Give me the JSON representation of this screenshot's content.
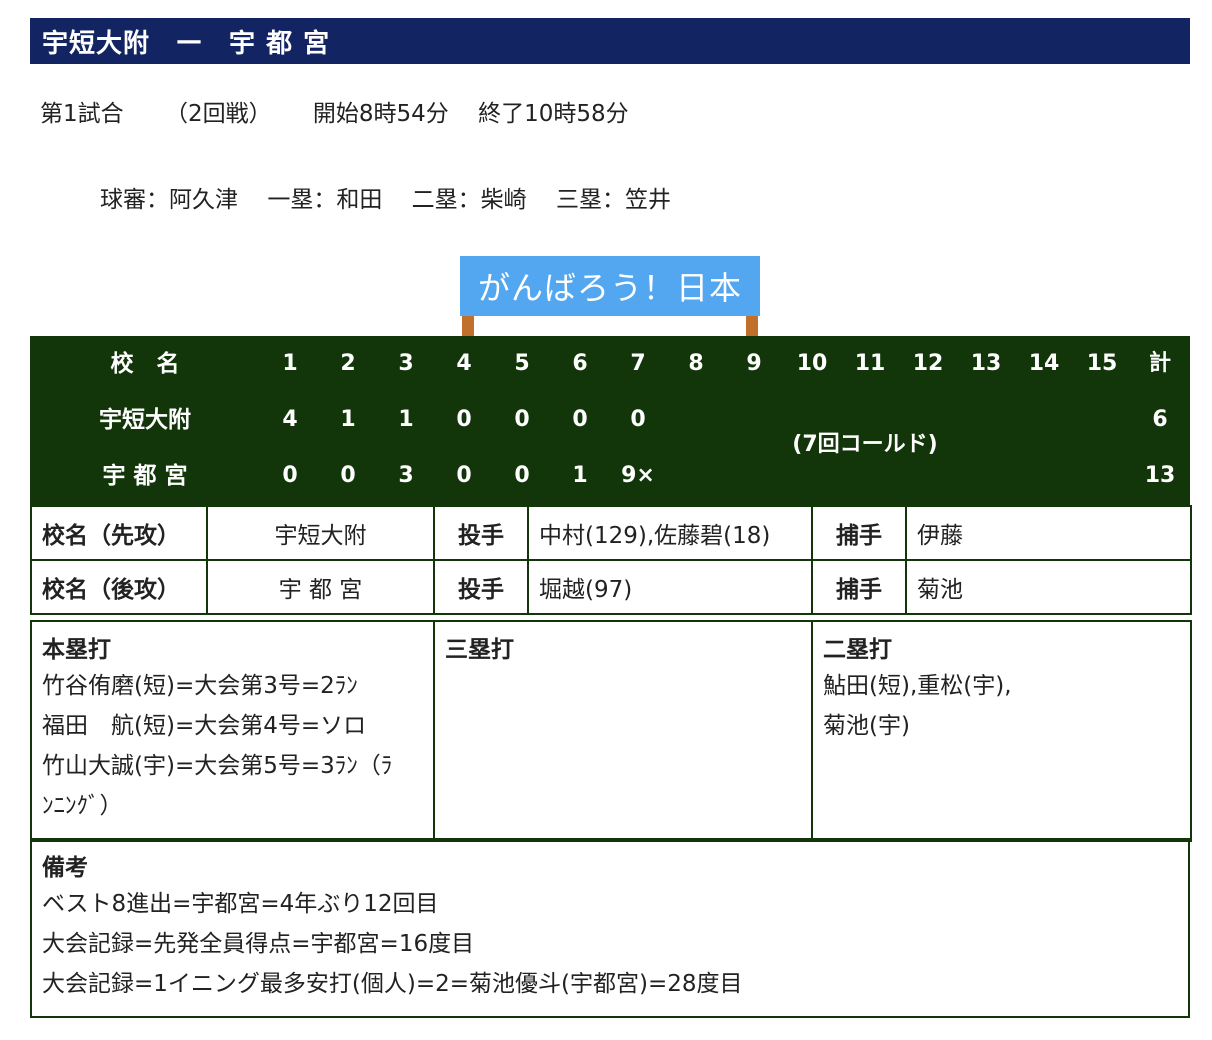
{
  "header": {
    "home_team": "宇短大附",
    "separator": "—",
    "away_team": "宇 都 宮"
  },
  "match_info": {
    "game": "第1試合",
    "round": "（2回戦）",
    "start": "開始8時54分",
    "end": "終了10時58分"
  },
  "umpires": {
    "plate": "球審：阿久津",
    "first": "一塁：和田",
    "second": "二塁：柴崎",
    "third": "三塁：笠井"
  },
  "banner": {
    "text": "がんばろう！日本"
  },
  "scoreboard": {
    "name_header": "校　名",
    "innings": [
      "1",
      "2",
      "3",
      "4",
      "5",
      "6",
      "7",
      "8",
      "9",
      "10",
      "11",
      "12",
      "13",
      "14",
      "15"
    ],
    "total_header": "計",
    "teams": [
      {
        "name": "宇短大附",
        "scores": [
          "4",
          "1",
          "1",
          "0",
          "0",
          "0",
          "0"
        ],
        "total": "6"
      },
      {
        "name": "宇 都 宮",
        "scores": [
          "0",
          "0",
          "3",
          "0",
          "0",
          "1",
          "9×"
        ],
        "total": "13"
      }
    ],
    "note": "(7回コールド)"
  },
  "lineup": {
    "rows": [
      {
        "label": "校名（先攻）",
        "team": "宇短大附",
        "pitcher_label": "投手",
        "pitchers": "中村(129),佐藤碧(18)",
        "catcher_label": "捕手",
        "catcher": "伊藤"
      },
      {
        "label": "校名（後攻）",
        "team": "宇 都 宮",
        "pitcher_label": "投手",
        "pitchers": "堀越(97)",
        "catcher_label": "捕手",
        "catcher": "菊池"
      }
    ]
  },
  "hits": {
    "home_runs": {
      "label": "本塁打",
      "lines": [
        "竹谷侑磨(短)=大会第3号=2ﾗﾝ",
        "福田　航(短)=大会第4号=ソロ",
        "竹山大誠(宇)=大会第5号=3ﾗﾝ（ﾗ",
        "ﾝﾆﾝｸﾞ）"
      ]
    },
    "triples": {
      "label": "三塁打",
      "lines": []
    },
    "doubles": {
      "label": "二塁打",
      "lines": [
        "鮎田(短),重松(宇),",
        "菊池(宇)"
      ]
    }
  },
  "remarks": {
    "label": "備考",
    "lines": [
      "ベスト8進出=宇都宮=4年ぶり12回目",
      "大会記録=先発全員得点=宇都宮=16度目",
      "大会記録=1イニング最多安打(個人)=2=菊池優斗(宇都宮)=28度目"
    ]
  }
}
